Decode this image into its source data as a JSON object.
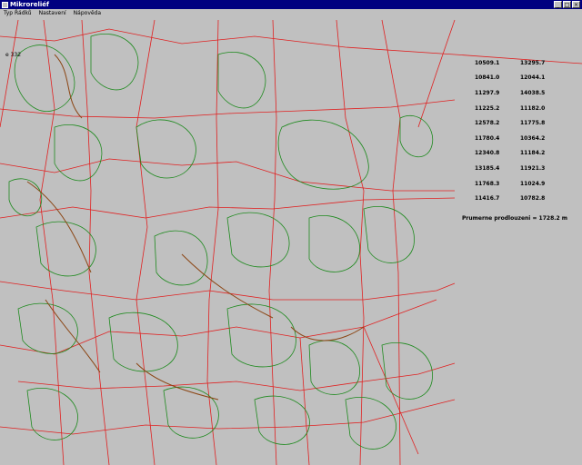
{
  "window": {
    "title": "Mikroreliéf"
  },
  "menu": [
    {
      "label": "Typ Řádků"
    },
    {
      "label": "Nastavení"
    },
    {
      "label": "Nápověda"
    }
  ],
  "overlay": {
    "counter": "e 332",
    "values": [
      [
        "10509.1",
        "13295.7"
      ],
      [
        "10841.0",
        "12044.1"
      ],
      [
        "11297.9",
        "14038.5"
      ],
      [
        "11225.2",
        "11182.0"
      ],
      [
        "12578.2",
        "11775.8"
      ],
      [
        "11780.4",
        "10364.2"
      ],
      [
        "12340.8",
        "11184.2"
      ],
      [
        "13185.4",
        "11921.3"
      ],
      [
        "11768.3",
        "11024.9"
      ],
      [
        "11416.7",
        "10782.8"
      ]
    ],
    "average": "Prumerne prodlouzeni = 1728.2 m"
  },
  "colors": {
    "background": "#c0c0c0",
    "titlebar": "#000080",
    "lines_red": "#e02020",
    "contours_green": "#1e8a1e",
    "contours_brown": "#8b4513"
  }
}
